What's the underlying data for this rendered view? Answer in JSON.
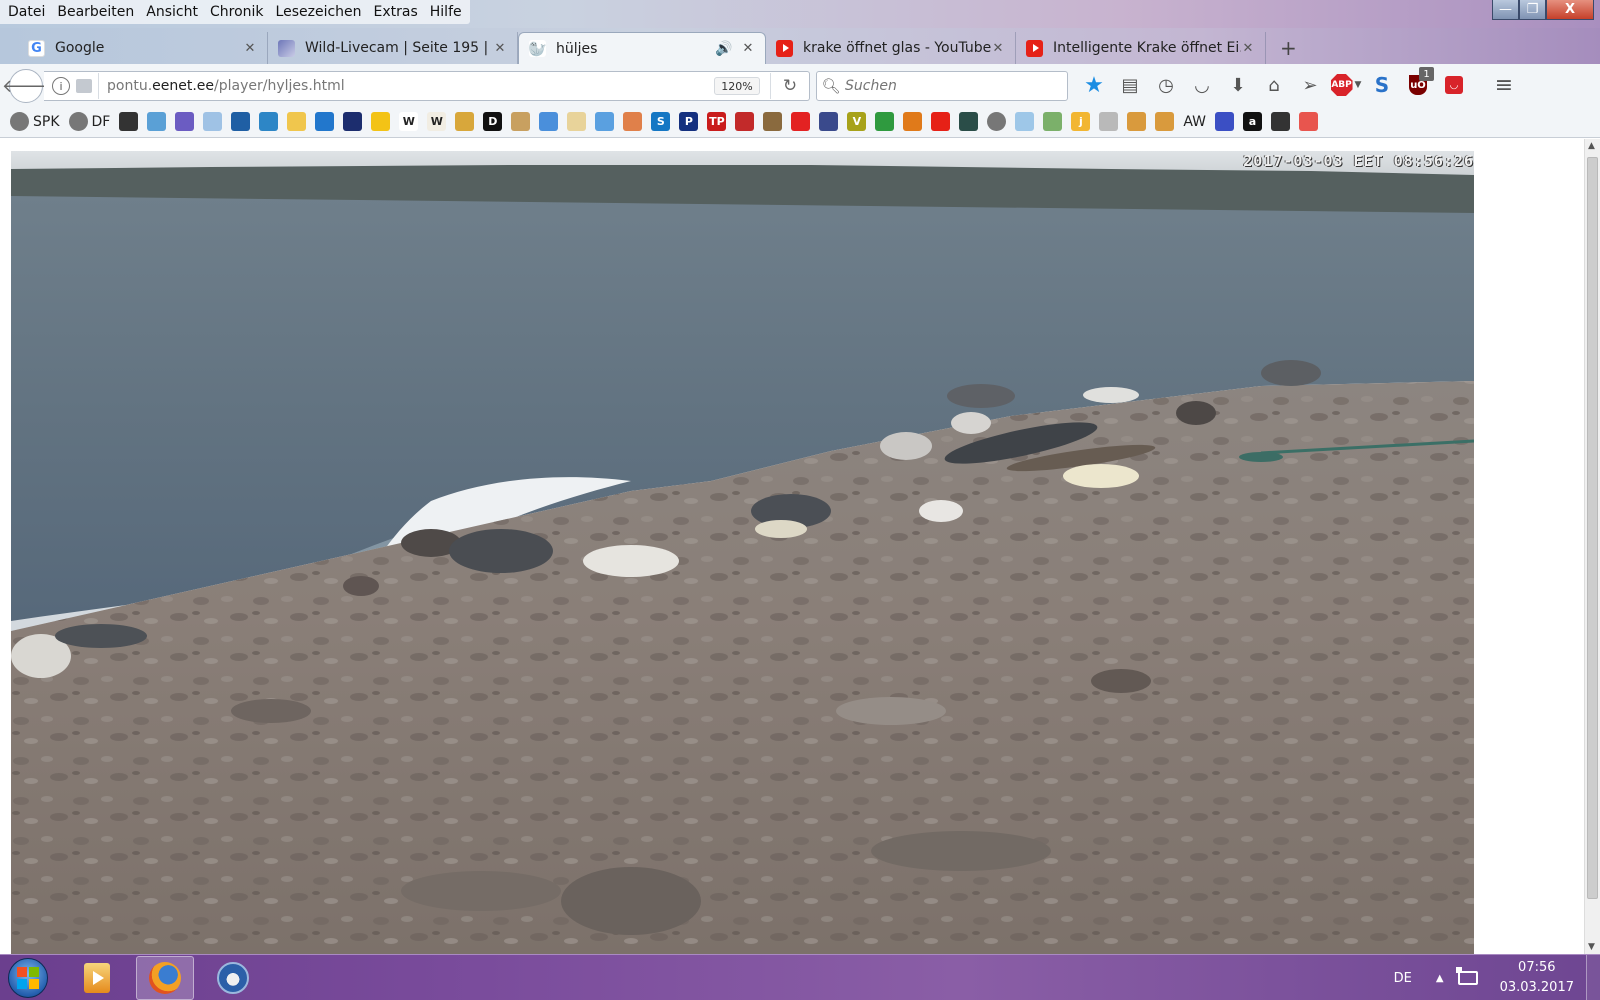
{
  "menu": [
    "Datei",
    "Bearbeiten",
    "Ansicht",
    "Chronik",
    "Lesezeichen",
    "Extras",
    "Hilfe"
  ],
  "window_controls": {
    "minimize": "—",
    "maximize": "❐",
    "close": "X"
  },
  "tabs": [
    {
      "title": "Google",
      "icon": "google-icon",
      "active": false
    },
    {
      "title": "Wild-Livecam | Seite 195 | ...",
      "icon": "site-icon",
      "active": false
    },
    {
      "title": "hüljes",
      "icon": "seal-icon",
      "active": true,
      "audio": true
    },
    {
      "title": "krake öffnet glas - YouTube",
      "icon": "youtube-icon",
      "active": false
    },
    {
      "title": "Intelligente Krake öffnet Ei...",
      "icon": "youtube-icon",
      "active": false
    }
  ],
  "new_tab": "+",
  "nav": {
    "url_prefix": "pontu.",
    "url_domain": "eenet.ee",
    "url_path": "/player/hyljes.html",
    "zoom": "120%",
    "search_placeholder": "Suchen"
  },
  "toolbar_icons": [
    "bookmark-star-icon",
    "reading-list-icon",
    "history-icon",
    "pocket-icon",
    "download-icon",
    "home-icon",
    "send-icon",
    "adblock-plus-icon",
    "s-extension-icon",
    "ublock-icon",
    "red-extension-icon",
    "hamburger-menu-icon"
  ],
  "ublock_badge": "1",
  "bookmarks": [
    {
      "label": "SPK",
      "icon": "globe-icon",
      "color": "#777777"
    },
    {
      "label": "DF",
      "icon": "globe-icon",
      "color": "#777777"
    },
    {
      "label": "",
      "icon": "bookmark-icon",
      "color": "#333333"
    },
    {
      "label": "",
      "icon": "bookmark-icon",
      "color": "#5aa0d6"
    },
    {
      "label": "",
      "icon": "bookmark-icon",
      "color": "#6b5cc2"
    },
    {
      "label": "",
      "icon": "bookmark-icon",
      "color": "#9fc2e5"
    },
    {
      "label": "",
      "icon": "bookmark-icon",
      "color": "#1f5fa4"
    },
    {
      "label": "",
      "icon": "bookmark-icon",
      "color": "#2d86c6"
    },
    {
      "label": "",
      "icon": "bookmark-icon",
      "color": "#f0c64d"
    },
    {
      "label": "",
      "icon": "bookmark-icon",
      "color": "#2277cc"
    },
    {
      "label": "",
      "icon": "bookmark-icon",
      "color": "#1c2d6e"
    },
    {
      "label": "",
      "icon": "smiley-icon",
      "color": "#f3c316"
    },
    {
      "label": "W",
      "icon": "wikipedia-icon",
      "color": "#ffffff"
    },
    {
      "label": "W",
      "icon": "wikipedia-icon",
      "color": "#f1ede3"
    },
    {
      "label": "",
      "icon": "bookmark-icon",
      "color": "#d8a73b"
    },
    {
      "label": "D",
      "icon": "bookmark-icon",
      "color": "#111111"
    },
    {
      "label": "",
      "icon": "book-icon",
      "color": "#c8a060"
    },
    {
      "label": "",
      "icon": "translate-icon",
      "color": "#4a8fdb"
    },
    {
      "label": "",
      "icon": "bookmark-icon",
      "color": "#e8d39a"
    },
    {
      "label": "",
      "icon": "bookmark-icon",
      "color": "#5aa0e0"
    },
    {
      "label": "",
      "icon": "bookmark-icon",
      "color": "#e0804a"
    },
    {
      "label": "S",
      "icon": "bookmark-icon",
      "color": "#1577c4"
    },
    {
      "label": "P",
      "icon": "paypal-icon",
      "color": "#14307f"
    },
    {
      "label": "TP",
      "icon": "bookmark-icon",
      "color": "#c91c1c"
    },
    {
      "label": "",
      "icon": "bookmark-icon",
      "color": "#c22a2a"
    },
    {
      "label": "",
      "icon": "bookmark-icon",
      "color": "#8a6a3e"
    },
    {
      "label": "",
      "icon": "bookmark-icon",
      "color": "#e32222"
    },
    {
      "label": "",
      "icon": "bookmark-icon",
      "color": "#3a4a8c"
    },
    {
      "label": "V",
      "icon": "bookmark-icon",
      "color": "#a7a21a"
    },
    {
      "label": "",
      "icon": "bookmark-icon",
      "color": "#2f9a3f"
    },
    {
      "label": "",
      "icon": "bookmark-icon",
      "color": "#e07a1a"
    },
    {
      "label": "",
      "icon": "youtube-icon",
      "color": "#e62117"
    },
    {
      "label": "",
      "icon": "bookmark-icon",
      "color": "#2a4d48"
    },
    {
      "label": "",
      "icon": "globe-icon",
      "color": "#777777"
    },
    {
      "label": "",
      "icon": "bookmark-icon",
      "color": "#9ec7e8"
    },
    {
      "label": "",
      "icon": "bookmark-icon",
      "color": "#7bb06a"
    },
    {
      "label": "j",
      "icon": "bookmark-icon",
      "color": "#f2b632"
    },
    {
      "label": "",
      "icon": "alien-icon",
      "color": "#b9b9b9"
    },
    {
      "label": "",
      "icon": "bookmark-icon",
      "color": "#d99a3d"
    },
    {
      "label": "",
      "icon": "bookmark-icon",
      "color": "#d99a3d"
    },
    {
      "label": "AW",
      "icon": "bookmark-icon",
      "color": "#f2f5f8"
    },
    {
      "label": "",
      "icon": "bookmark-icon",
      "color": "#3b4fc4"
    },
    {
      "label": "a",
      "icon": "amazon-icon",
      "color": "#111111"
    },
    {
      "label": "",
      "icon": "museum-icon",
      "color": "#333333"
    },
    {
      "label": "",
      "icon": "bookmark-icon",
      "color": "#e8554e"
    }
  ],
  "camera": {
    "timestamp": "2017-03-03 EET 08:56:26"
  },
  "taskbar": {
    "language": "DE",
    "time": "07:56",
    "date": "03.03.2017"
  }
}
